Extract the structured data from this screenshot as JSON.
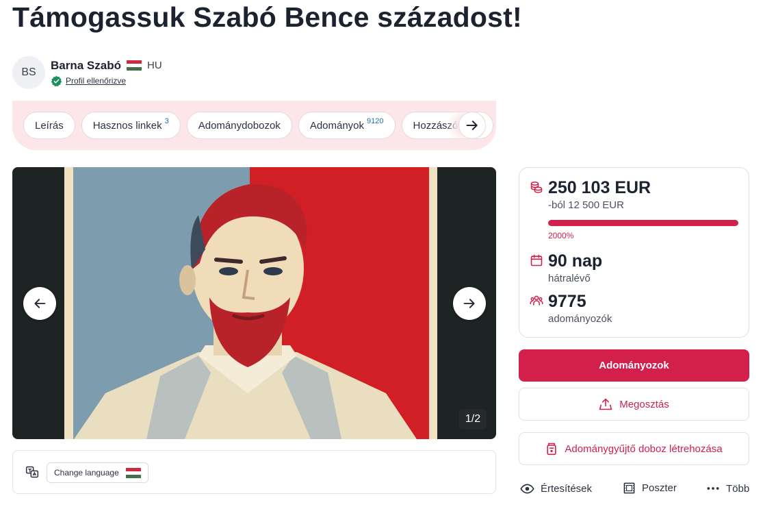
{
  "campaign": {
    "title": "Támogassuk Szabó Bence századost!"
  },
  "author": {
    "initials": "BS",
    "name": "Barna Szabó",
    "country": "HU",
    "verified_label": "Profil ellenőrizve"
  },
  "tabs": [
    {
      "label": "Leírás",
      "badge": ""
    },
    {
      "label": "Hasznos linkek",
      "badge": "3"
    },
    {
      "label": "Adománydobozok",
      "badge": ""
    },
    {
      "label": "Adományok",
      "badge": "9120"
    },
    {
      "label": "Hozzászólások",
      "badge": ""
    }
  ],
  "gallery": {
    "counter": "1/2"
  },
  "language": {
    "button_label": "Change language"
  },
  "stats": {
    "raised": "250 103 EUR",
    "goal": "-ból 12 500 EUR",
    "progress_fraction": 1.0,
    "percent": "2000%",
    "days": "90 nap",
    "days_label": "hátralévő",
    "donors": "9775",
    "donors_label": "adományozók"
  },
  "actions": {
    "donate": "Adományozok",
    "share": "Megosztás",
    "create_box": "Adománygyűjtő doboz létrehozása",
    "notifications": "Értesítések",
    "poster": "Poszter",
    "more": "Több"
  },
  "colors": {
    "accent": "#d21f4c",
    "tabs_background": "#fce6ea",
    "verified": "#1f8f5f",
    "hu_red": "#cd2a3e",
    "hu_green": "#436f4d"
  },
  "icons": {
    "verified": "check-badge-icon",
    "raised": "coins-icon",
    "days": "calendar-icon",
    "donors": "people-icon",
    "share": "share-icon",
    "box": "donation-box-icon",
    "notifications": "eye-icon",
    "poster": "poster-icon",
    "more": "ellipsis-icon",
    "language": "translate-icon"
  }
}
